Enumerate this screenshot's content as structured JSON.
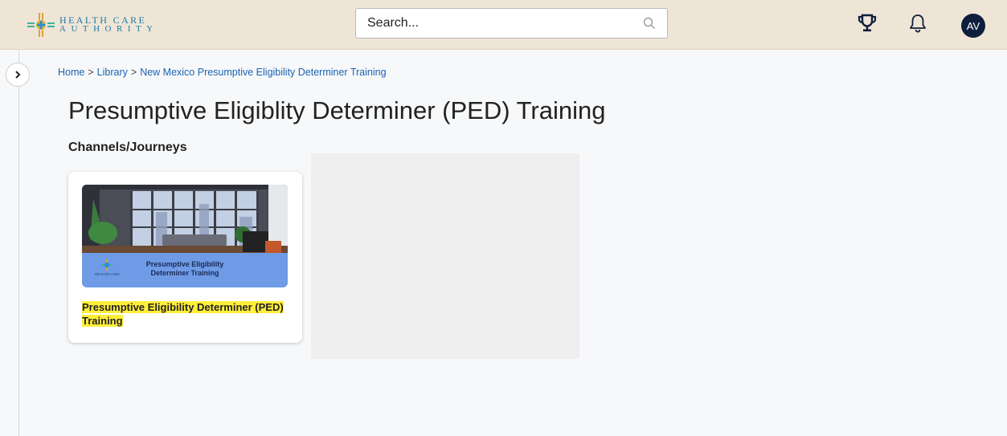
{
  "header": {
    "logo": {
      "line1": "HEALTH CARE",
      "line2": "AUTHORITY"
    },
    "search": {
      "placeholder": "Search..."
    },
    "user": {
      "initials": "AV"
    },
    "icons": [
      "trophy-icon",
      "bell-icon",
      "search-icon"
    ]
  },
  "sidebar": {
    "toggle_icon": "chevron-right-icon"
  },
  "breadcrumb": {
    "items": [
      "Home",
      "Library",
      "New Mexico Presumptive Eligibility Determiner Training"
    ],
    "separator": ">"
  },
  "page": {
    "title": "Presumptive Eligiblity Determiner (PED) Training",
    "section_title": "Channels/Journeys"
  },
  "cards": [
    {
      "thumbnail_text_line1": "Presumptive Eligibility",
      "thumbnail_text_line2": "Determiner Training",
      "thumbnail_logo_text": "HEALTH CARE",
      "title": "Presumptive Eligibility Determiner (PED) Training",
      "highlight_color": "#ffee3a"
    }
  ],
  "colors": {
    "topbar": "#efe5d6",
    "brand_blue": "#1a7aa8",
    "link": "#1a63b0",
    "avatar": "#0f1e3c",
    "header_icons": "#0f1e3c"
  }
}
